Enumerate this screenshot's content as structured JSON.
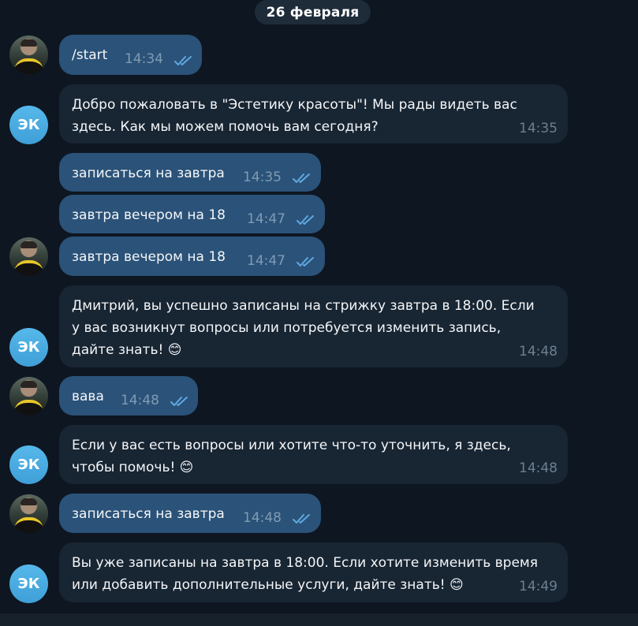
{
  "date_label": "26 февраля",
  "bot_avatar_initials": "ЭК",
  "messages": [
    {
      "text": "/start",
      "time": "14:34"
    },
    {
      "text": "Добро пожаловать в \"Эстетику красоты\"! Мы рады видеть вас\nздесь. Как мы можем помочь вам сегодня?",
      "time": "14:35"
    },
    {
      "text": "записаться на завтра",
      "time": "14:35"
    },
    {
      "text": "завтра вечером на 18",
      "time": "14:47"
    },
    {
      "text": "завтра вечером на 18",
      "time": "14:47"
    },
    {
      "text": "Дмитрий, вы успешно записаны на стрижку завтра в 18:00. Если\nу вас возникнут вопросы или потребуется изменить запись,\nдайте знать! 😊",
      "time": "14:48"
    },
    {
      "text": "вава",
      "time": "14:48"
    },
    {
      "text": "Если у вас есть вопросы или хотите что-то уточнить, я здесь,\nчтобы помочь! 😊",
      "time": "14:48"
    },
    {
      "text": "записаться на завтра",
      "time": "14:48"
    },
    {
      "text": "Вы уже записаны на завтра в 18:00. Если хотите изменить время\nили добавить дополнительные услуги, дайте знать! 😊",
      "time": "14:49"
    }
  ]
}
